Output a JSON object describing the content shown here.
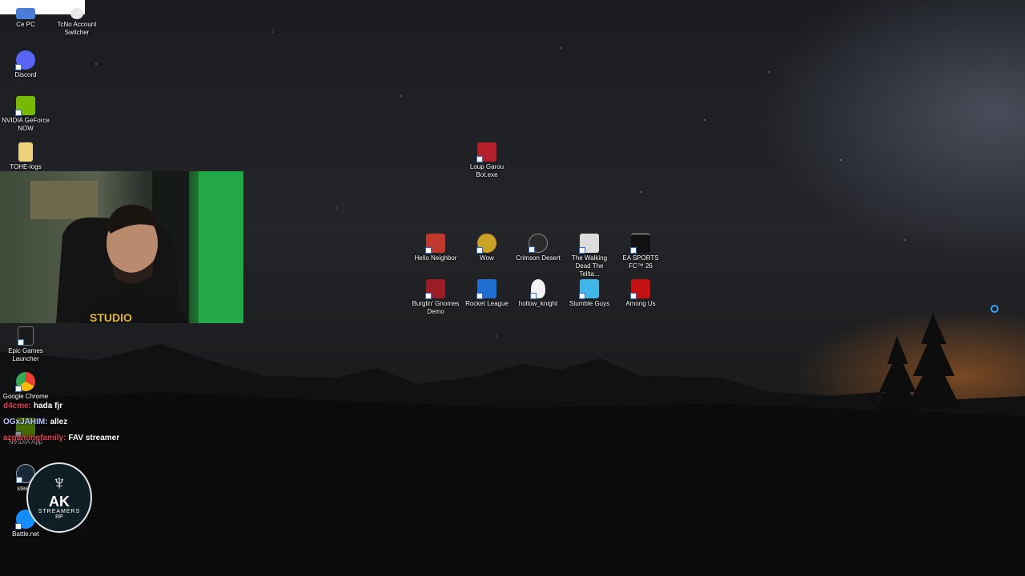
{
  "desktop": {
    "icons_left": [
      {
        "label": "Ce PC",
        "icon": "pc-icon",
        "color": "#4a7ed6"
      },
      {
        "label": "TcNo Account Switcher",
        "icon": "account-switcher-icon",
        "color": "#e8e8e8"
      },
      {
        "label": "Discord",
        "icon": "discord-icon",
        "color": "#5865f2"
      },
      {
        "label": "NVIDIA GeForce NOW",
        "icon": "nvidia-geforce-now-icon",
        "color": "#76b900"
      },
      {
        "label": "TOHE-logs",
        "icon": "folder-icon",
        "color": "#f0d27a"
      },
      {
        "label": "Epic Games Launcher",
        "icon": "epic-games-icon",
        "color": "#1a1a1a"
      },
      {
        "label": "Google Chrome",
        "icon": "chrome-icon",
        "color": "#e94235"
      },
      {
        "label": "NVIDIA App",
        "icon": "nvidia-app-icon",
        "color": "#76b900"
      },
      {
        "label": "steam",
        "icon": "steam-icon",
        "color": "#1b2838"
      },
      {
        "label": "Battle.net",
        "icon": "battlenet-icon",
        "color": "#148eff"
      }
    ],
    "icons_center": [
      {
        "label": "Loup Garou Bot.exe",
        "icon": "loup-garou-icon",
        "color": "#b3202a"
      },
      {
        "label": "Hello Neighbor",
        "icon": "hello-neighbor-icon",
        "color": "#c0392b"
      },
      {
        "label": "Wow",
        "icon": "wow-icon",
        "color": "#c9a227"
      },
      {
        "label": "Crimson Desert",
        "icon": "crimson-desert-icon",
        "color": "#2b2b2b"
      },
      {
        "label": "The Walking Dead The Tellta...",
        "icon": "walking-dead-icon",
        "color": "#dcdcdc"
      },
      {
        "label": "EA SPORTS FC™ 26",
        "icon": "ea-fc-icon",
        "color": "#111111"
      },
      {
        "label": "Burglin' Gnomes Demo",
        "icon": "burglin-gnomes-icon",
        "color": "#9b1c24"
      },
      {
        "label": "Rocket League",
        "icon": "rocket-league-icon",
        "color": "#1f6fd1"
      },
      {
        "label": "hollow_knight",
        "icon": "hollow-knight-icon",
        "color": "#f2f2f2"
      },
      {
        "label": "Stumble Guys",
        "icon": "stumble-guys-icon",
        "color": "#3fb6e8"
      },
      {
        "label": "Among Us",
        "icon": "among-us-icon",
        "color": "#c51111"
      }
    ]
  },
  "chat": [
    {
      "user": "d4cme:",
      "message": "hada fjr",
      "color": "#e0404a"
    },
    {
      "user": "OGxJAHIM:",
      "message": "allez",
      "color": "#b9c4ff"
    },
    {
      "user": "azgamingfamily:",
      "message": "FAV streamer",
      "color": "#e0404a"
    }
  ],
  "badge": {
    "line1": "AK",
    "line2": "STREAMERS",
    "line3": "RP"
  }
}
